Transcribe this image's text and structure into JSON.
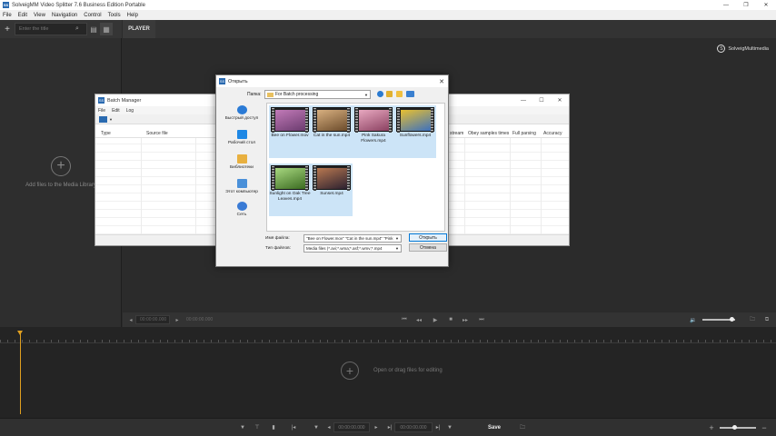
{
  "app": {
    "title": "SolveigMM Video Splitter 7.6 Business Edition Portable",
    "icon_text": "SS",
    "window_controls": [
      "—",
      "❐",
      "✕"
    ]
  },
  "menu": [
    "File",
    "Edit",
    "View",
    "Navigation",
    "Control",
    "Tools",
    "Help"
  ],
  "library": {
    "add_icon": "+",
    "search_placeholder": "Enter the title",
    "search_icon": "⌕",
    "view_icons": [
      "▤",
      "▦"
    ],
    "empty_plus": "+",
    "empty_text": "Add files to the Media Library"
  },
  "player": {
    "tab": "PLAYER",
    "brand": "SolveigMultimedia",
    "time_start": "00:00:00.000",
    "time_end": "00:00:00.000",
    "controls": [
      "◂",
      "▸",
      "⏮",
      "◂◂",
      "▶",
      "■",
      "▸▸",
      "⏭"
    ],
    "volume_level": 0.9,
    "right_icons": [
      "🔉",
      "🗀",
      "⧉"
    ]
  },
  "timeline": {
    "drop_plus": "+",
    "drop_text": "Open or drag files for editing"
  },
  "bottombar": {
    "time1": "00:00:00.000",
    "time2": "00:00:00.000",
    "save": "Save",
    "zoom_plus": "+",
    "zoom_minus": "−",
    "zoom_level": 0.4,
    "icons": [
      "▼",
      "⊤",
      "▮",
      "|◂",
      "▼",
      "◂",
      "▸",
      "▸|",
      "▼",
      "🗀",
      "▸|"
    ]
  },
  "batch_manager": {
    "title": "Batch Manager",
    "icon_text": "SS",
    "window_controls": [
      "—",
      "☐",
      "✕"
    ],
    "menu": [
      "File",
      "Edit",
      "Log"
    ],
    "columns": [
      "Type",
      "Source file",
      "stream",
      "Obey samples times",
      "Full parsing",
      "Accuracy"
    ]
  },
  "open_dialog": {
    "title": "Открыть",
    "icon_text": "SS",
    "close": "✕",
    "folder_label": "Папка:",
    "folder_value": "For Batch processing",
    "places": [
      {
        "label": "Быстрый доступ",
        "color": "#2b7bd6"
      },
      {
        "label": "Рабочий стол",
        "color": "#1e88e5"
      },
      {
        "label": "Библиотеки",
        "color": "#e8b040"
      },
      {
        "label": "Этот компьютер",
        "color": "#4a90d9"
      },
      {
        "label": "Сеть",
        "color": "#3a7bd5"
      }
    ],
    "files": [
      {
        "name": "Bee on Flower.mov",
        "c1": "#c27ab8",
        "c2": "#6a3b6e"
      },
      {
        "name": "Cat in the sun.mp4",
        "c1": "#d8b080",
        "c2": "#6a4a2a"
      },
      {
        "name": "Pink Sakura Flowers.mp4",
        "c1": "#e8a8c0",
        "c2": "#8a4060"
      },
      {
        "name": "Sunflowers.mp4",
        "c1": "#e8c030",
        "c2": "#3a70c0"
      },
      {
        "name": "Sunlight on Oak Tree Leaves.mp4",
        "c1": "#a8d880",
        "c2": "#3a6a20"
      },
      {
        "name": "Sunset.mp4",
        "c1": "#b87850",
        "c2": "#2a2030"
      }
    ],
    "filename_label": "Имя файла:",
    "filename_value": "\"Bee on Flower.mov\" \"Cat in the sun.mp4\" \"Pink",
    "filetype_label": "Тип файлов:",
    "filetype_value": "Media files (*.avi;*.wma;*.asf;*.wmv;*.mp4",
    "open_button": "Открыть",
    "cancel_button": "Отмена"
  }
}
